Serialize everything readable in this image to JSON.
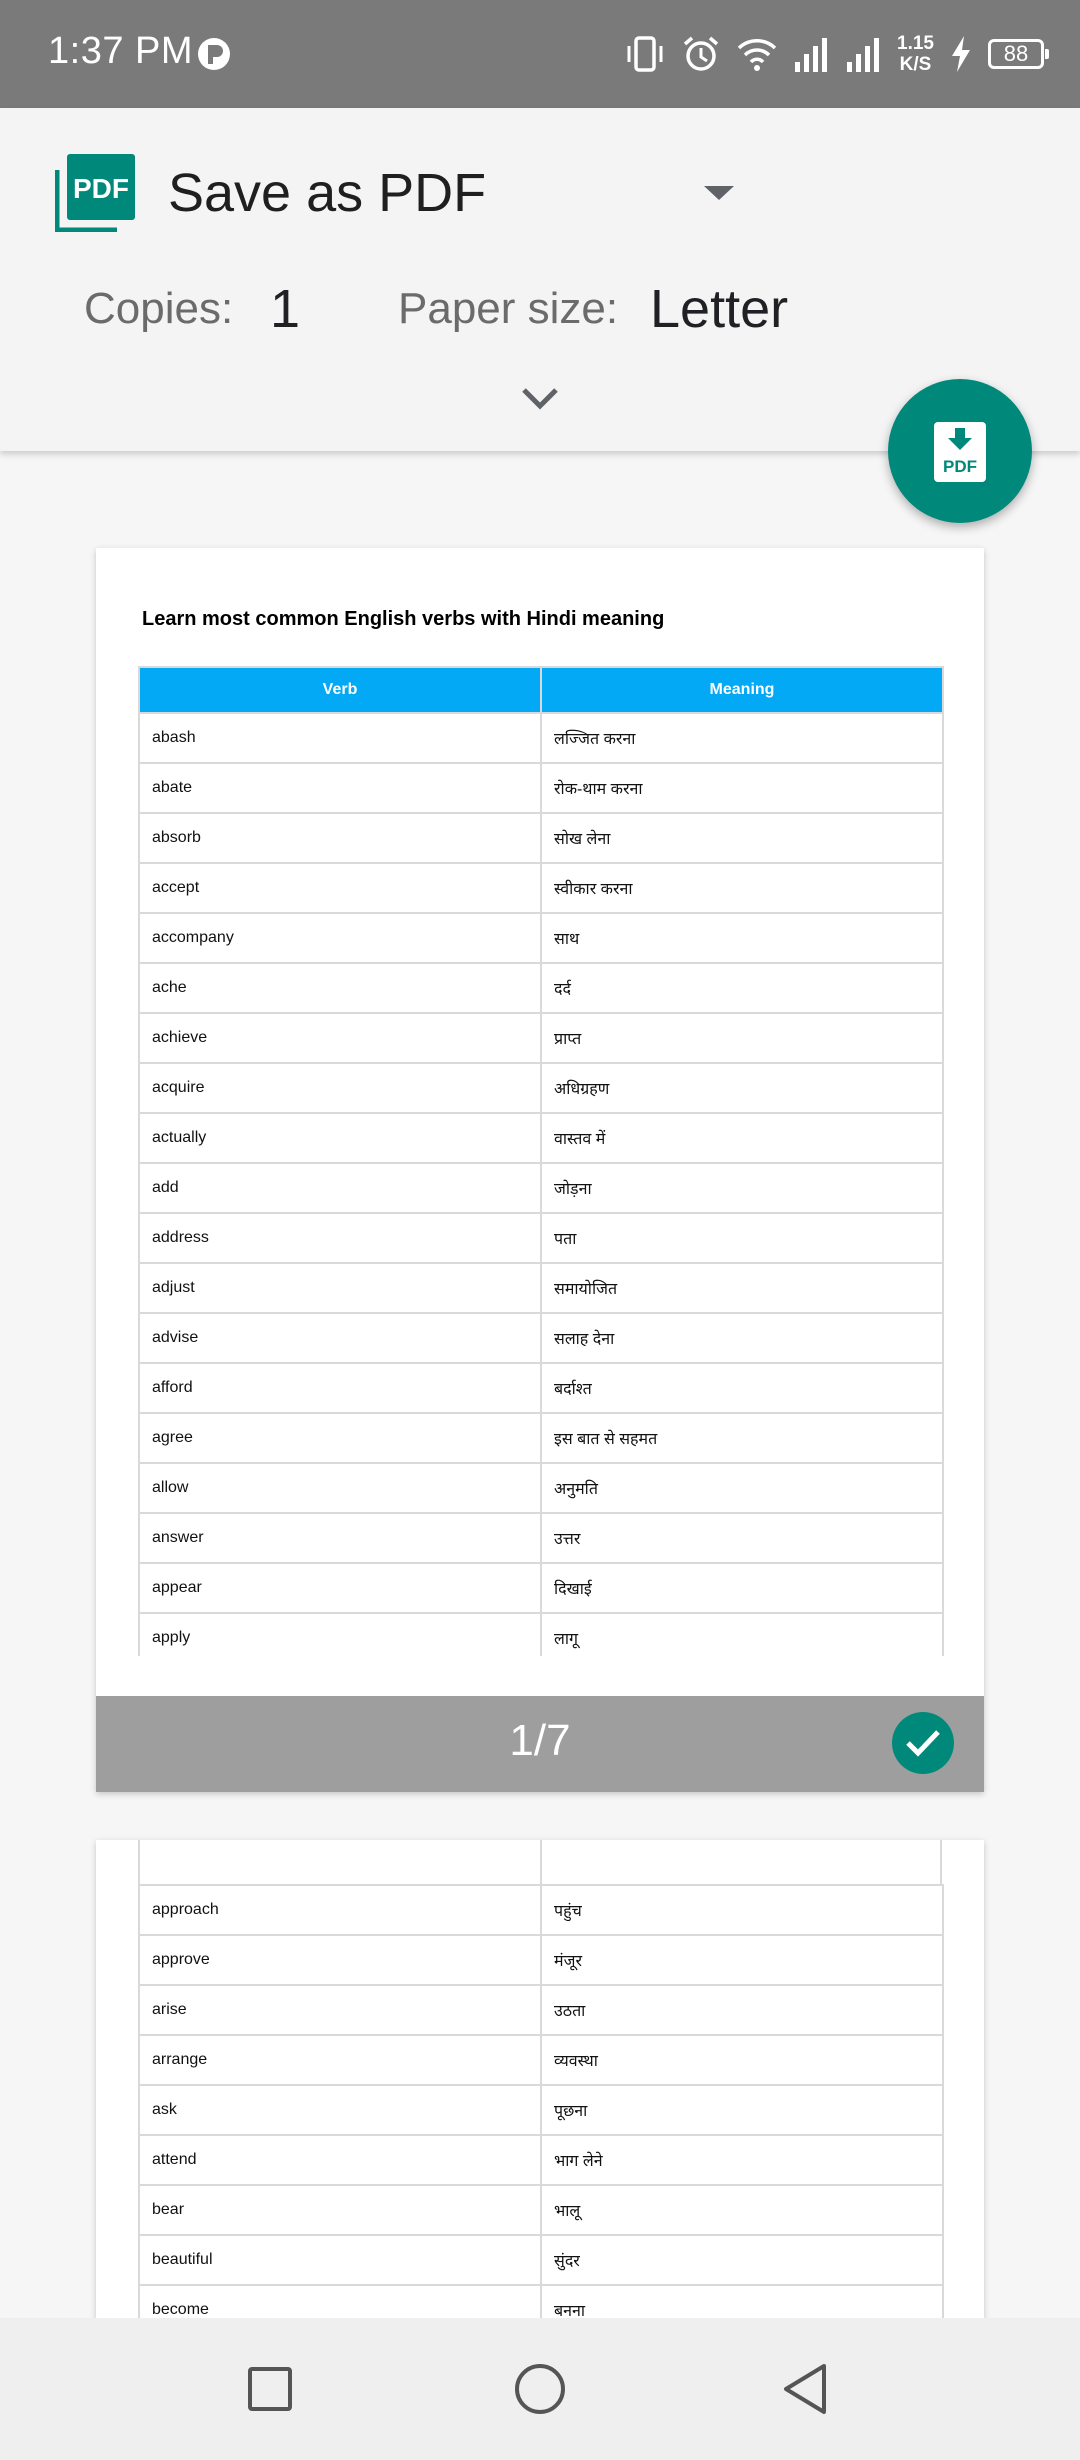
{
  "status_bar": {
    "time": "1:37 PM",
    "net_speed_value": "1.15",
    "net_speed_unit": "K/S",
    "battery": "88",
    "icons": [
      "vibrate-icon",
      "alarm-icon",
      "wifi-icon",
      "signal-icon",
      "signal-icon",
      "charging-icon"
    ]
  },
  "header": {
    "printer_name": "Save as PDF",
    "copies_label": "Copies:",
    "copies_value": "1",
    "paper_size_label": "Paper size:",
    "paper_size_value": "Letter",
    "logo_text": "PDF"
  },
  "fab": {
    "icon": "download-pdf-icon",
    "text": "PDF"
  },
  "colors": {
    "accent": "#00897b",
    "table_header": "#03a9f4",
    "status_bar": "#7a7a7a",
    "page_footer": "#9e9e9e"
  },
  "page1": {
    "title": "Learn most common English verbs with Hindi meaning",
    "columns": [
      "Verb",
      "Meaning"
    ],
    "rows": [
      [
        "abash",
        "लज्जित करना"
      ],
      [
        "abate",
        "रोक-थाम करना"
      ],
      [
        "absorb",
        "सोख लेना"
      ],
      [
        "accept",
        "स्वीकार करना"
      ],
      [
        "accompany",
        "साथ"
      ],
      [
        "ache",
        "दर्द"
      ],
      [
        "achieve",
        "प्राप्त"
      ],
      [
        "acquire",
        "अधिग्रहण"
      ],
      [
        "actually",
        "वास्तव में"
      ],
      [
        "add",
        "जोड़ना"
      ],
      [
        "address",
        "पता"
      ],
      [
        "adjust",
        "समायोजित"
      ],
      [
        "advise",
        "सलाह देना"
      ],
      [
        "afford",
        "बर्दाश्त"
      ],
      [
        "agree",
        "इस बात से सहमत"
      ],
      [
        "allow",
        "अनुमति"
      ],
      [
        "answer",
        "उत्तर"
      ],
      [
        "appear",
        "दिखाई"
      ],
      [
        "apply",
        "लागू"
      ]
    ],
    "page_number": "1/7"
  },
  "page2": {
    "rows": [
      [
        "approach",
        "पहुंच"
      ],
      [
        "approve",
        "मंजूर"
      ],
      [
        "arise",
        "उठता"
      ],
      [
        "arrange",
        "व्यवस्था"
      ],
      [
        "ask",
        "पूछना"
      ],
      [
        "attend",
        "भाग लेने"
      ],
      [
        "bear",
        "भालू"
      ],
      [
        "beautiful",
        "सुंदर"
      ],
      [
        "become",
        "बनना"
      ]
    ]
  },
  "nav": {
    "recents": "square-icon",
    "home": "circle-icon",
    "back": "triangle-back-icon"
  }
}
